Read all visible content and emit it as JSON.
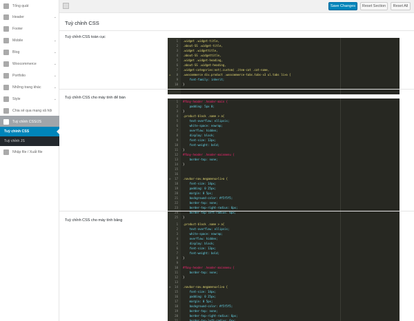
{
  "sidebar": {
    "top": "Tổng quát",
    "items": [
      {
        "label": "Header",
        "chevron": true
      },
      {
        "label": "Footer",
        "chevron": false
      },
      {
        "label": "Mobile",
        "chevron": true
      },
      {
        "label": "Blog",
        "chevron": true
      },
      {
        "label": "Woocommerce",
        "chevron": true
      },
      {
        "label": "Portfolio",
        "chevron": true
      },
      {
        "label": "Những trang khác",
        "chevron": true
      },
      {
        "label": "Style",
        "chevron": true
      },
      {
        "label": "Chia sẻ qua mạng xã hội",
        "chevron": false
      }
    ],
    "active": "Tuỳ chỉnh CSS/JS",
    "subs": [
      "Tuỳ chỉnh CSS",
      "Tuỳ chỉnh JS"
    ],
    "after": "Nhập file / Xuất file"
  },
  "toolbar": {
    "save": "Save Changes",
    "reset_section": "Reset Section",
    "reset_all": "Reset All"
  },
  "main": {
    "title": "Tuỳ chỉnh CSS",
    "sections": [
      {
        "label": "Tuỳ chỉnh CSS toàn cục",
        "lines": [
          ".widget .widget-title,",
          ".about-SS .widget-title,",
          ".widget .widgettitle,",
          ".about-SS .widgettitle,",
          ".widget .widget-heading,",
          ".about-SS .widget-heading,",
          ".widget-categories:not(.custom) .item-cat .cat-name,",
          ".woocommerce div.product .woocommerce-tabs.tabs-v3 ul.tabs li>a {",
          "    font-family: inherit;",
          "}"
        ],
        "warn_line": 8
      },
      {
        "label": "Tuỳ chỉnh CSS cho máy tính để bàn",
        "lines": [
          "#fbay-header .header-main {",
          "    padding: 5px 0;",
          "}",
          ".product-block .name > a{",
          "    text-overflow: ellipsis;",
          "    white-space: nowrap;",
          "    overflow: hidden;",
          "    display: block;",
          "    font-size: 13px;",
          "    font-weight: bold;",
          "}",
          "#fbay-header .header-mainmenu {",
          "    border-top: none;",
          "}",
          "",
          "",
          ".navbar-nav.megamenu>li>a {",
          "    font-size: 14px;",
          "    padding: 0 25px;",
          "    margin: 0 5px;",
          "    background-color: #f5f5f5;",
          "    border-top: none;",
          "    border-top-right-radius: 6px;",
          "    border-top-left-radius: 6px;",
          "}"
        ],
        "fold_line": 17
      },
      {
        "label": "Tuỳ chỉnh CSS cho máy tính bảng",
        "lines": [
          ".product-block .name > a{",
          "    text-overflow: ellipsis;",
          "    white-space: nowrap;",
          "    overflow: hidden;",
          "    display: block;",
          "    font-size: 13px;",
          "    font-weight: bold;",
          "}",
          "",
          "#fbay-header .header-mainmenu {",
          "    border-top: none;",
          "}",
          "",
          ".navbar-nav.megamenu>li>a {",
          "    font-size: 14px;",
          "    padding: 0 25px;",
          "    margin: 0 5px;",
          "    background-color: #f5f5f5;",
          "    border-top: none;",
          "    border-top-right-radius: 6px;",
          "    border-top-left-radius: 6px;",
          "}"
        ],
        "fold_line": 14
      }
    ]
  }
}
